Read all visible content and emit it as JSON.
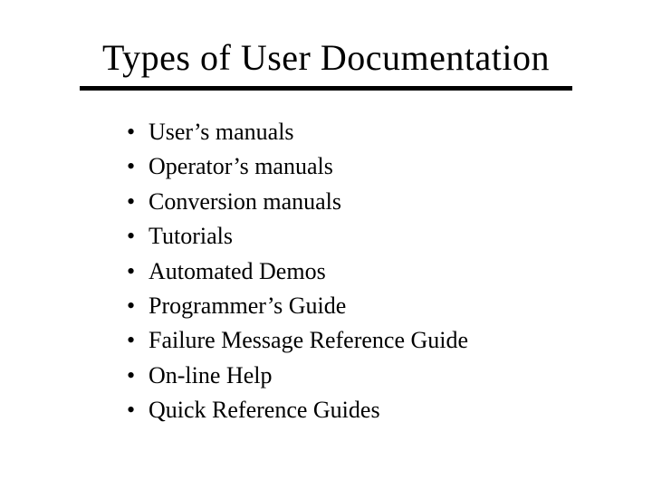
{
  "title": "Types of User Documentation",
  "bullets": [
    "User’s manuals",
    "Operator’s manuals",
    "Conversion manuals",
    "Tutorials",
    "Automated Demos",
    "Programmer’s Guide",
    "Failure Message Reference Guide",
    "On-line Help",
    "Quick Reference Guides"
  ]
}
